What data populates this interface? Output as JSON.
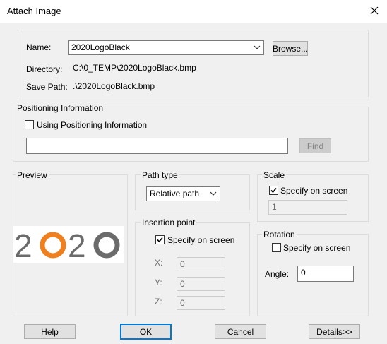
{
  "window": {
    "title": "Attach Image",
    "close_icon": "close-icon"
  },
  "file": {
    "name_label": "Name:",
    "name_value": "2020LogoBlack",
    "browse_label": "Browse...",
    "directory_label": "Directory:",
    "directory_value": "C:\\0_TEMP\\2020LogoBlack.bmp",
    "save_path_label": "Save Path:",
    "save_path_value": ".\\2020LogoBlack.bmp"
  },
  "positioning": {
    "group_label": "Positioning Information",
    "use_label": "Using Positioning Information",
    "use_checked": false,
    "path_value": "",
    "find_label": "Find"
  },
  "preview": {
    "group_label": "Preview",
    "logo": {
      "text": "2O2O",
      "colors": {
        "dark": "#6b6b6b",
        "accent": "#f07f1e"
      }
    }
  },
  "path_type": {
    "group_label": "Path type",
    "value": "Relative path"
  },
  "insertion": {
    "group_label": "Insertion point",
    "specify_label": "Specify on screen",
    "specify_checked": true,
    "x_label": "X:",
    "x_value": "0",
    "y_label": "Y:",
    "y_value": "0",
    "z_label": "Z:",
    "z_value": "0"
  },
  "scale": {
    "group_label": "Scale",
    "specify_label": "Specify on screen",
    "specify_checked": true,
    "value": "1"
  },
  "rotation": {
    "group_label": "Rotation",
    "specify_label": "Specify on screen",
    "specify_checked": false,
    "angle_label": "Angle:",
    "angle_value": "0"
  },
  "buttons": {
    "help": "Help",
    "ok": "OK",
    "cancel": "Cancel",
    "details": "Details>>"
  },
  "colors": {
    "accent_focus": "#0078d7",
    "dialog_bg": "#f0f0f0"
  }
}
